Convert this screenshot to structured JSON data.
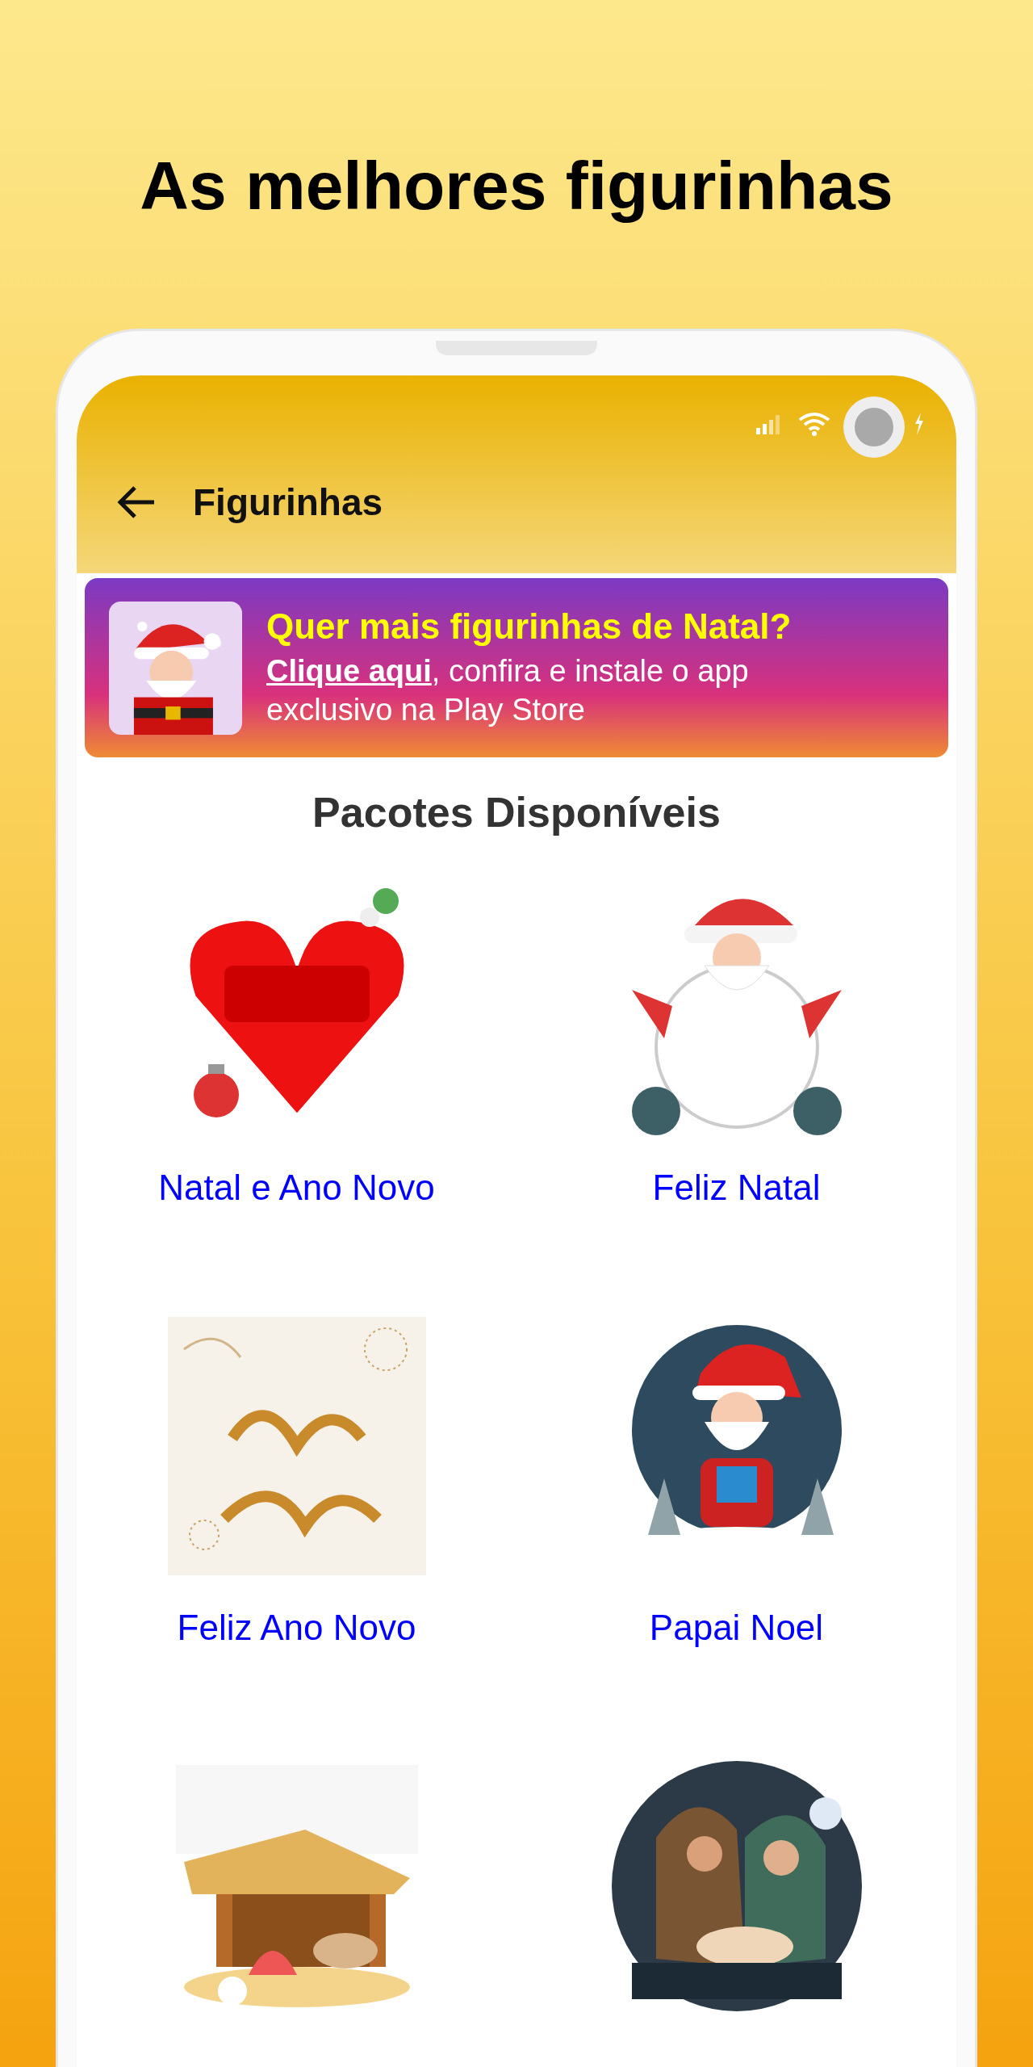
{
  "headline": "As melhores figurinhas",
  "app_bar": {
    "title": "Figurinhas"
  },
  "banner": {
    "title": "Quer mais figurinhas de Natal?",
    "link": "Clique aqui",
    "text": ", confira e instale o app exclusivo na Play Store"
  },
  "section_title": "Pacotes Disponíveis",
  "packs": [
    {
      "kind": "picture",
      "name": "Natal e Ano Novo"
    },
    {
      "kind": "picture",
      "name": "Feliz Natal"
    },
    {
      "kind": "picture",
      "name": "Feliz Ano Novo"
    },
    {
      "kind": "picture",
      "name": "Papai Noel"
    },
    {
      "kind": "picture"
    },
    {
      "kind": "picture"
    }
  ]
}
